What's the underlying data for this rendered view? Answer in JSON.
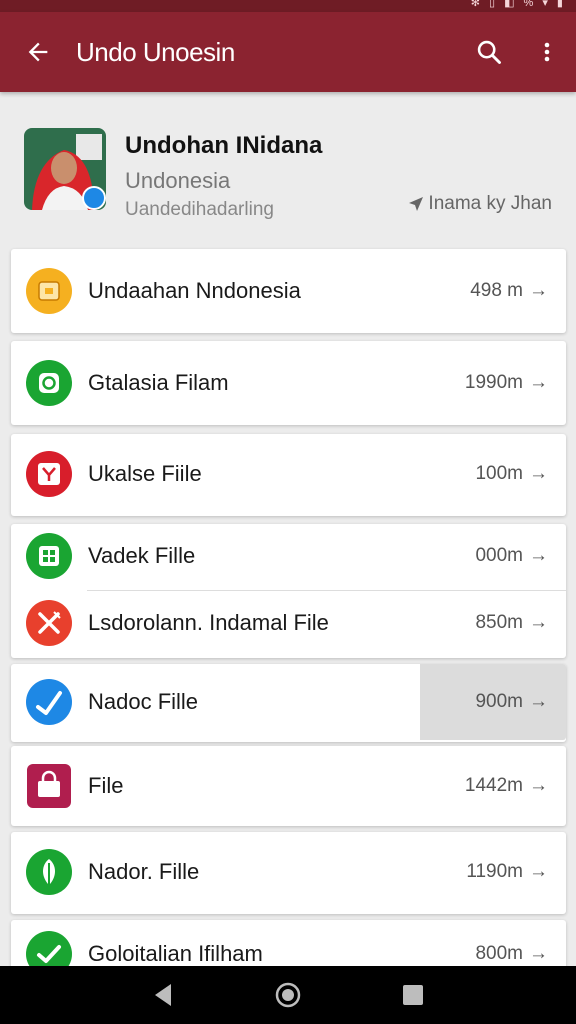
{
  "status_bar": {
    "icons": "✻ ▯ ◧ % ▾ ▮"
  },
  "app_bar": {
    "title": "Undo Unoesin"
  },
  "profile": {
    "name": "Undohan INidana",
    "subtitle": "Undonesia",
    "meta": "Uandedihadarling",
    "location": "Inama ky Jhan"
  },
  "files": [
    {
      "label": "Undaahan Nndonesia",
      "value": "498 m",
      "icon": "folder-icon",
      "color": "#f5b020"
    },
    {
      "label": "Gtalasia Filam",
      "value": "1990m",
      "icon": "sync-icon",
      "color": "#1aa532"
    },
    {
      "label": "Ukalse Fiile",
      "value": "100m",
      "icon": "y-badge-icon",
      "color": "#d81e2b"
    },
    {
      "label": "Vadek Fille",
      "value": "000m",
      "icon": "grid-icon",
      "color": "#1aa532"
    },
    {
      "label": "Lsdorolann. Indamal File",
      "value": "850m",
      "icon": "cross-tools-icon",
      "color": "#e8402d"
    },
    {
      "label": "Nadoc Fille",
      "value": "900m",
      "icon": "check-icon",
      "color": "#1e88e5"
    },
    {
      "label": "File",
      "value": "1442m",
      "icon": "shopping-bag-icon",
      "color": "#b01e4e"
    },
    {
      "label": "Nador. Fille",
      "value": "1190m",
      "icon": "leaf-icon",
      "color": "#1aa532"
    },
    {
      "label": "Goloitalian Ifilham",
      "value": "800m",
      "icon": "check-icon",
      "color": "#1aa532"
    }
  ],
  "colors": {
    "app_bar": "#8b2330",
    "background": "#ececec"
  }
}
